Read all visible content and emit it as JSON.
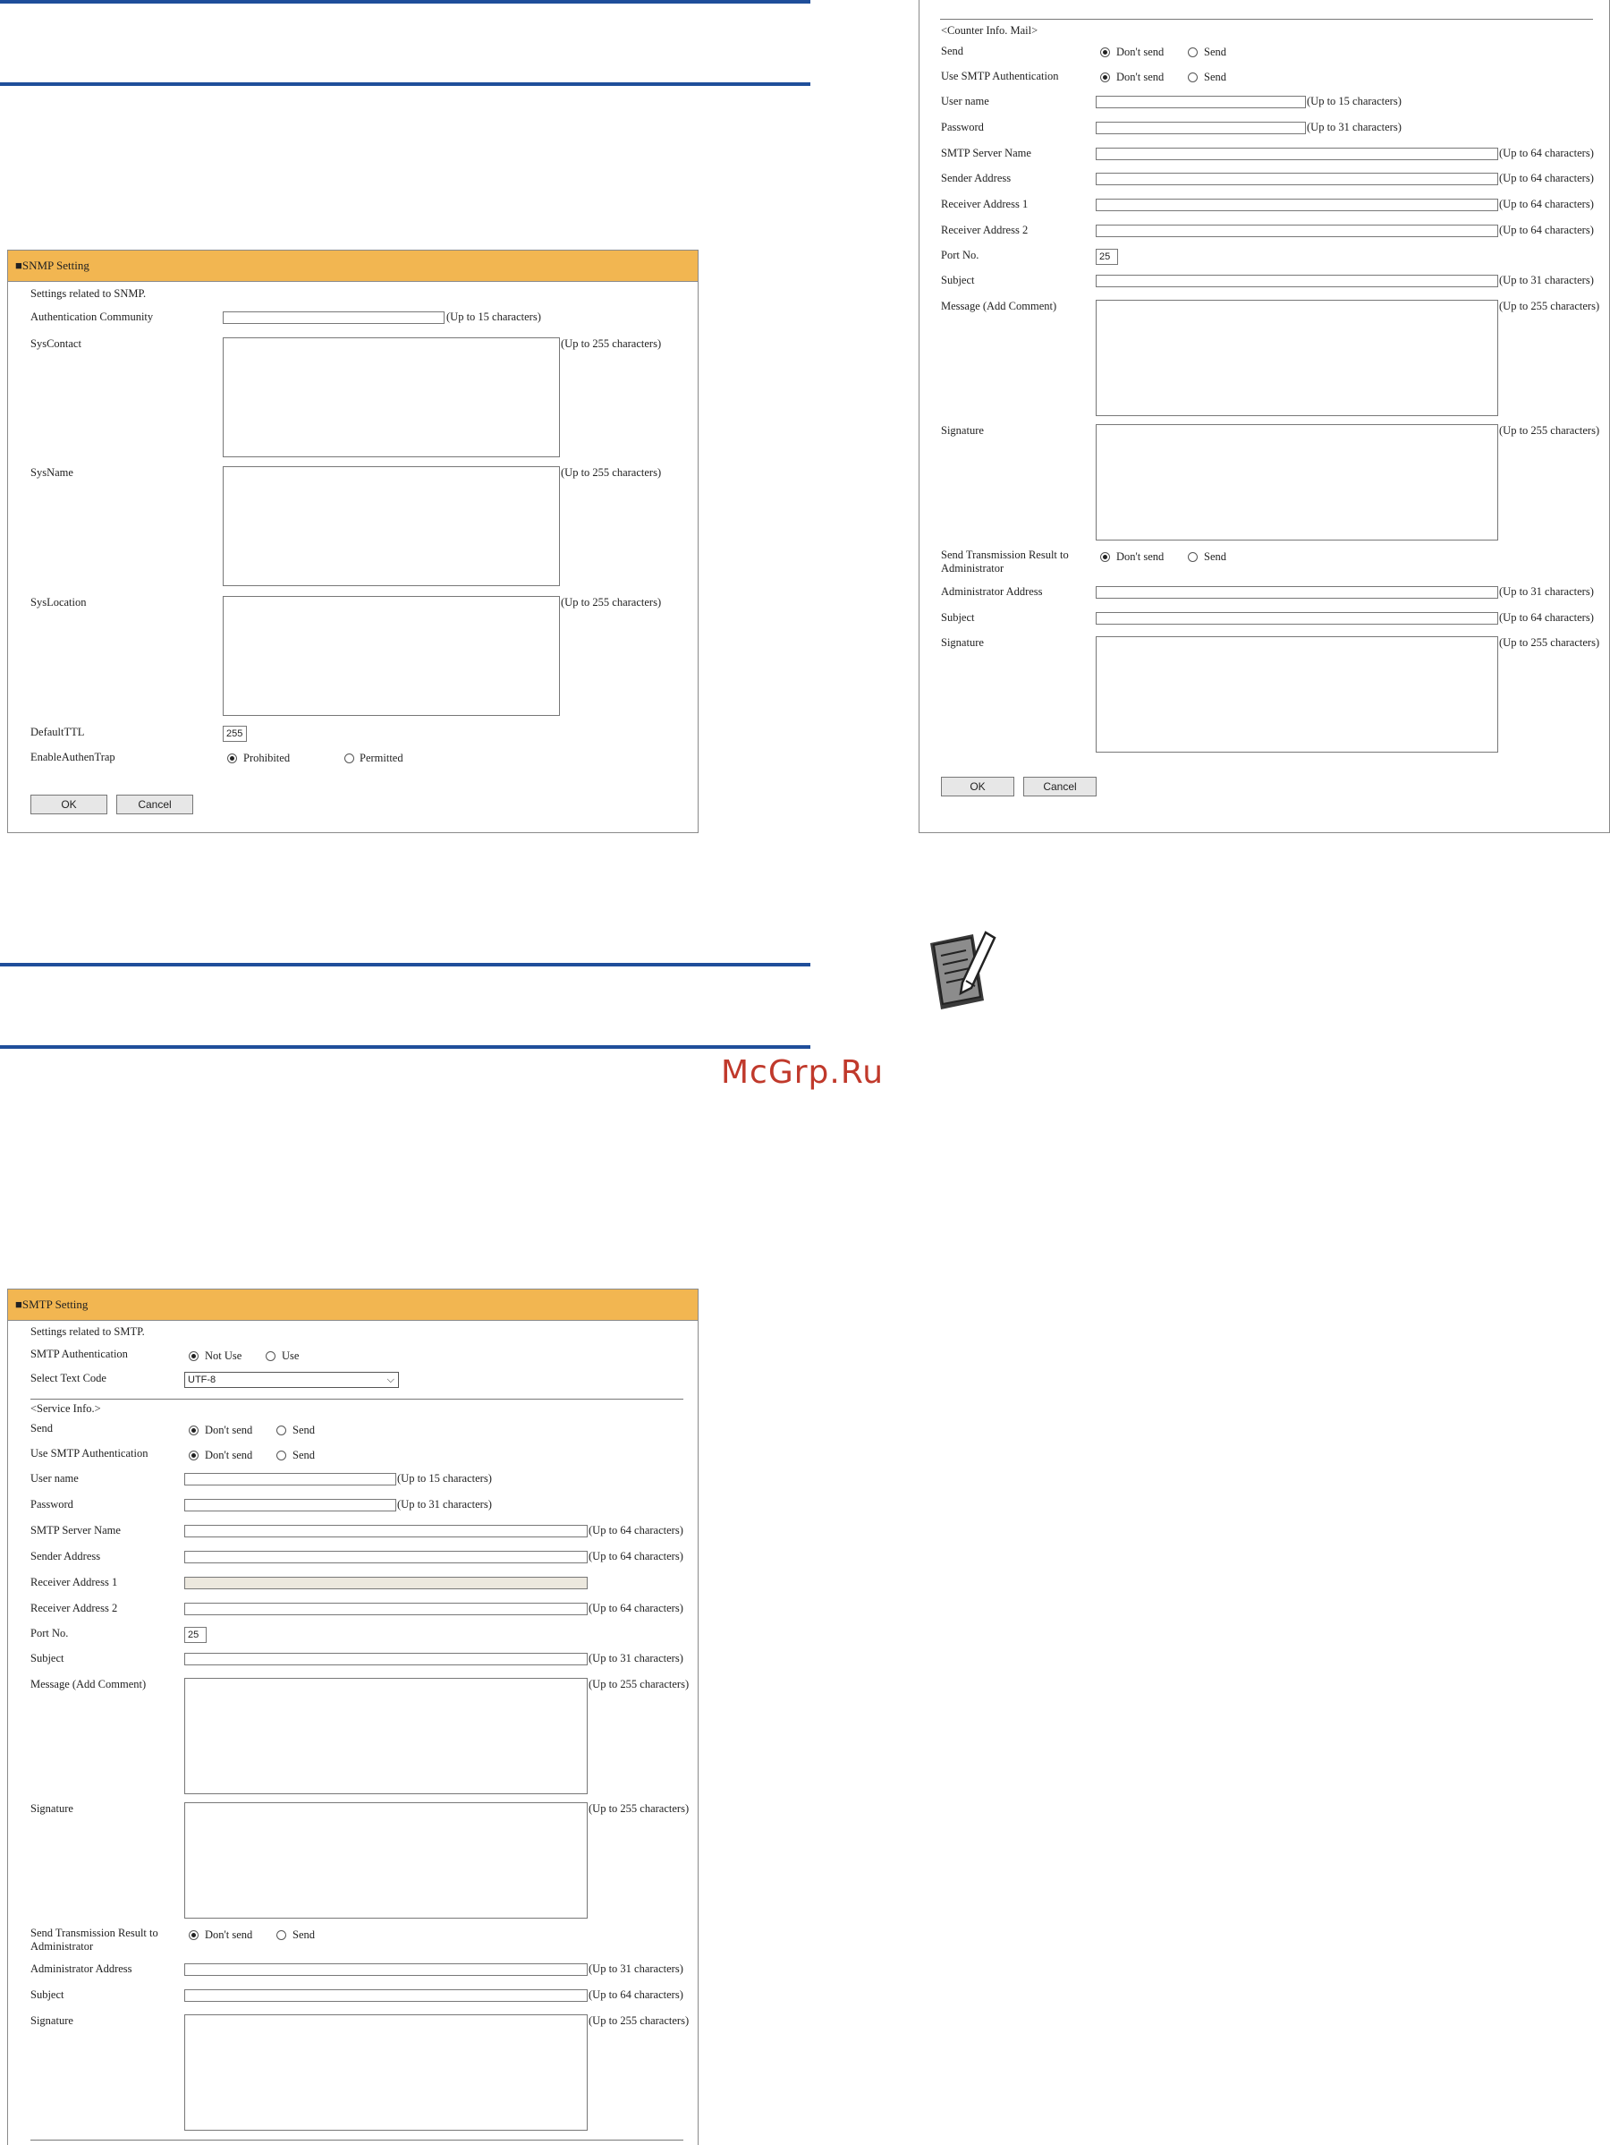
{
  "snmp": {
    "title": "■SNMP Setting",
    "intro": "Settings related to SNMP.",
    "auth_community_label": "Authentication Community",
    "auth_community_hint": "(Up to 15 characters)",
    "syscontact_label": "SysContact",
    "sysname_label": "SysName",
    "syslocation_label": "SysLocation",
    "hint_255": "(Up to 255 characters)",
    "default_ttl_label": "DefaultTTL",
    "default_ttl_value": "255",
    "enable_trap_label": "EnableAuthenTrap",
    "opt_prohibited": "Prohibited",
    "opt_permitted": "Permitted",
    "ok": "OK",
    "cancel": "Cancel"
  },
  "counter": {
    "section_label": "<Counter Info. Mail>",
    "send_label": "Send",
    "use_smtp_auth_label": "Use SMTP Authentication",
    "opt_dont_send": "Don't send",
    "opt_send": "Send",
    "user_name_label": "User name",
    "password_label": "Password",
    "smtp_server_label": "SMTP Server Name",
    "sender_label": "Sender Address",
    "receiver1_label": "Receiver Address 1",
    "receiver2_label": "Receiver Address 2",
    "port_label": "Port No.",
    "port_value": "25",
    "subject_label": "Subject",
    "message_label": "Message (Add Comment)",
    "signature_label": "Signature",
    "send_result_label": "Send Transmission Result to Administrator",
    "admin_address_label": "Administrator Address",
    "hint_15": "(Up to 15 characters)",
    "hint_31": "(Up to 31 characters)",
    "hint_64": "(Up to 64 characters)",
    "hint_255": "(Up to 255 characters)",
    "ok": "OK",
    "cancel": "Cancel"
  },
  "smtp": {
    "title": "■SMTP Setting",
    "intro": "Settings related to SMTP.",
    "smtp_auth_label": "SMTP Authentication",
    "opt_not_use": "Not Use",
    "opt_use": "Use",
    "text_code_label": "Select Text Code",
    "text_code_value": "UTF-8",
    "service_label": "<Service Info.>",
    "send_label": "Send",
    "use_smtp_auth_label": "Use SMTP Authentication",
    "opt_dont_send": "Don't send",
    "opt_send": "Send",
    "user_name_label": "User name",
    "password_label": "Password",
    "smtp_server_label": "SMTP Server Name",
    "sender_label": "Sender Address",
    "receiver1_label": "Receiver Address 1",
    "receiver2_label": "Receiver Address 2",
    "port_label": "Port No.",
    "port_value": "25",
    "subject_label": "Subject",
    "message_label": "Message (Add Comment)",
    "signature_label": "Signature",
    "send_result_label": "Send Transmission Result to Administrator",
    "admin_address_label": "Administrator Address",
    "hint_15": "(Up to 15 characters)",
    "hint_31": "(Up to 31 characters)",
    "hint_64": "(Up to 64 characters)",
    "hint_255": "(Up to 255 characters)"
  },
  "watermark": "McGrp.Ru",
  "icons": {
    "note": "note-pencil-icon"
  }
}
